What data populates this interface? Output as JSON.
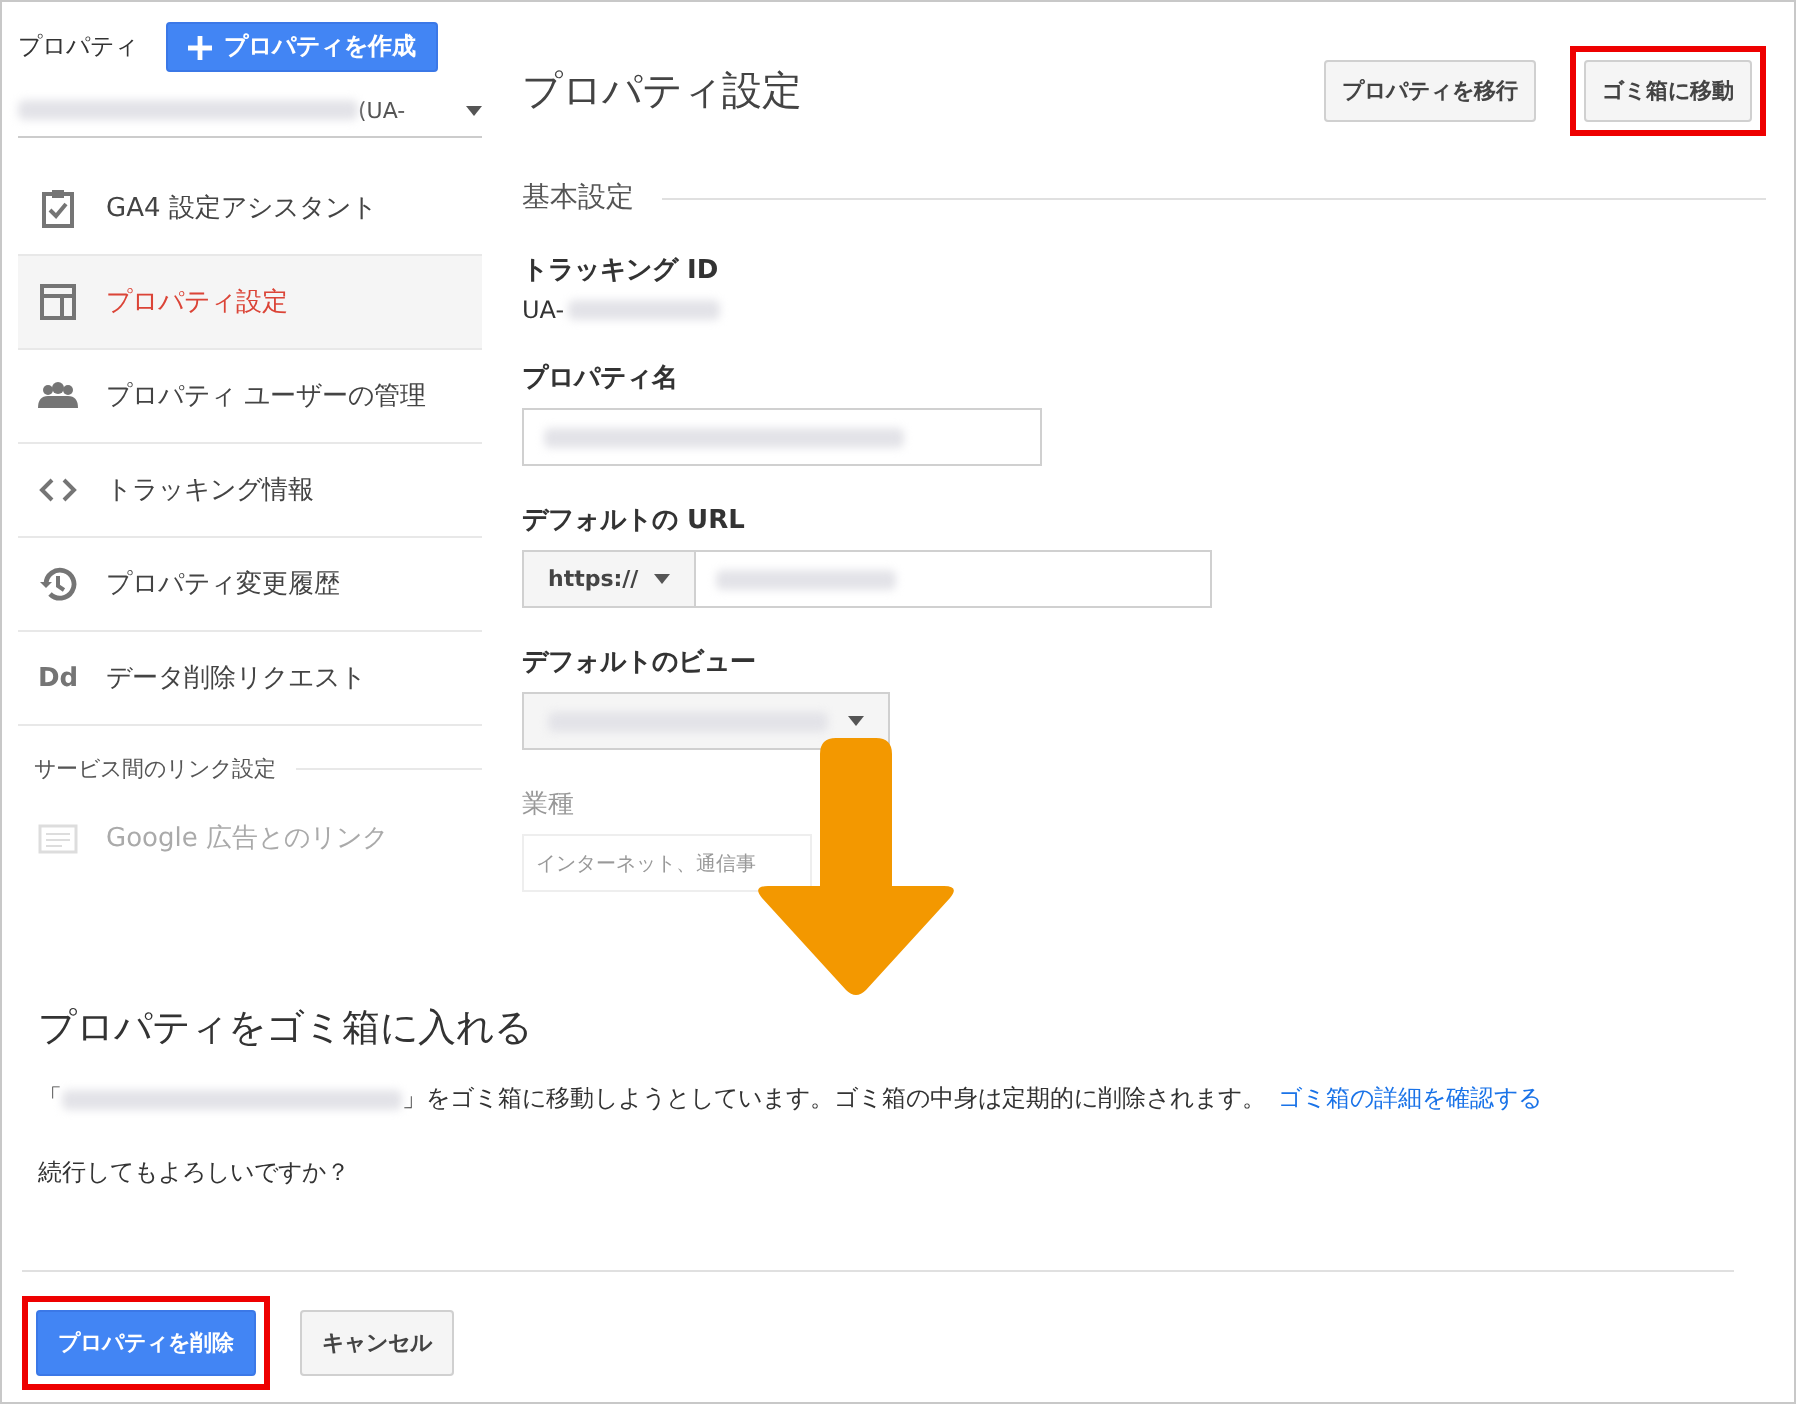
{
  "sidebar": {
    "label": "プロパティ",
    "create_button": "プロパティを作成",
    "property_select": {
      "suffix": "(UA-"
    },
    "items": [
      {
        "label": "GA4 設定アシスタント",
        "selected": false,
        "faded": false
      },
      {
        "label": "プロパティ設定",
        "selected": true,
        "faded": false
      },
      {
        "label": "プロパティ ユーザーの管理",
        "selected": false,
        "faded": false
      },
      {
        "label": "トラッキング情報",
        "selected": false,
        "faded": false
      },
      {
        "label": "プロパティ変更履歴",
        "selected": false,
        "faded": false
      },
      {
        "icon_text": "Dd",
        "label": "データ削除リクエスト",
        "selected": false,
        "faded": false
      }
    ],
    "section_title": "サービス間のリンク設定",
    "section_items": [
      {
        "label": "Google 広告とのリンク",
        "faded": true
      }
    ]
  },
  "main": {
    "title": "プロパティ設定",
    "buttons": [
      {
        "label": "プロパティを移行",
        "highlighted": false
      },
      {
        "label": "ゴミ箱に移動",
        "highlighted": true
      }
    ],
    "section": "基本設定",
    "tracking_id": {
      "label": "トラッキング ID",
      "value_prefix": "UA-"
    },
    "property_name": {
      "label": "プロパティ名"
    },
    "default_url": {
      "label": "デフォルトの URL",
      "protocol": "https://"
    },
    "default_view": {
      "label": "デフォルトのビュー"
    },
    "industry": {
      "label": "業種",
      "value": "インターネット、通信事"
    }
  },
  "dialog": {
    "title": "プロパティをゴミ箱に入れる",
    "quote_open": "「",
    "message": "」をゴミ箱に移動しようとしています。ゴミ箱の中身は定期的に削除されます。",
    "link": "ゴミ箱の詳細を確認する",
    "question": "続行してもよろしいですか？",
    "buttons": [
      {
        "kind": "primary",
        "label": "プロパティを削除",
        "highlighted": true
      },
      {
        "kind": "secondary",
        "label": "キャンセル",
        "highlighted": false
      }
    ]
  }
}
